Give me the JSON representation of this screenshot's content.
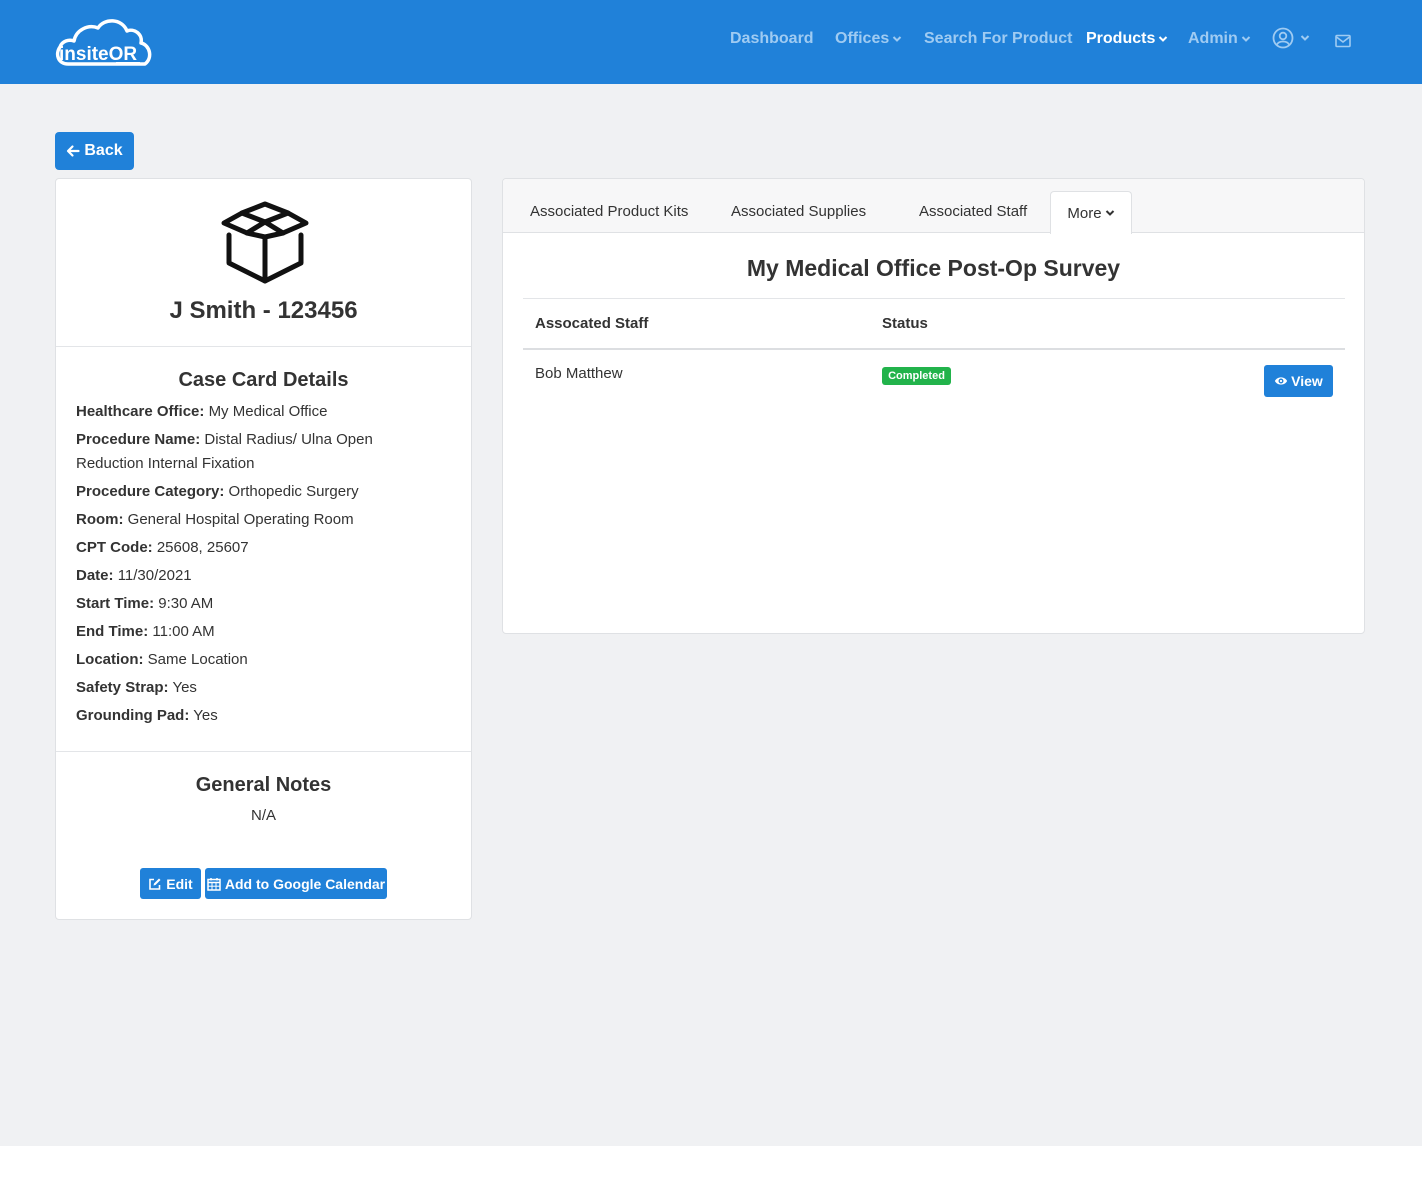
{
  "app": {
    "logo_text": "insiteOR"
  },
  "nav": {
    "dashboard": "Dashboard",
    "offices": "Offices",
    "search_for_product": "Search For Product",
    "products": "Products",
    "admin": "Admin"
  },
  "back_label": "Back",
  "case": {
    "title": "J Smith - 123456",
    "details_heading": "Case Card Details",
    "fields": [
      {
        "label": "Healthcare Office:",
        "value": "My Medical Office"
      },
      {
        "label": "Procedure Name:",
        "value": "Distal Radius/ Ulna Open Reduction Internal Fixation"
      },
      {
        "label": "Procedure Category:",
        "value": "Orthopedic Surgery"
      },
      {
        "label": "Room:",
        "value": "General Hospital Operating Room"
      },
      {
        "label": "CPT Code:",
        "value": "25608, 25607"
      },
      {
        "label": "Date:",
        "value": "11/30/2021"
      },
      {
        "label": "Start Time:",
        "value": "9:30 AM"
      },
      {
        "label": "End Time:",
        "value": "11:00 AM"
      },
      {
        "label": "Location:",
        "value": "Same Location"
      },
      {
        "label": "Safety Strap:",
        "value": "Yes"
      },
      {
        "label": "Grounding Pad:",
        "value": "Yes"
      }
    ],
    "notes_heading": "General Notes",
    "notes_value": "N/A",
    "edit_label": "Edit",
    "calendar_label": "Add to Google Calendar"
  },
  "tabs": {
    "kits": "Associated Product Kits",
    "supplies": "Associated Supplies",
    "staff": "Associated Staff",
    "more": "More"
  },
  "survey": {
    "title": "My Medical Office Post-Op Survey",
    "col_staff": "Assocated Staff",
    "col_status": "Status",
    "rows": [
      {
        "staff": "Bob Matthew",
        "status": "Completed",
        "action": "View"
      }
    ]
  },
  "colors": {
    "primary": "#2081d9",
    "nav_link": "#9fcbf2",
    "success": "#22b34b",
    "page_bg": "#f0f1f3"
  },
  "icons": {
    "logo": "cloud-logo-icon",
    "user": "user-circle-icon",
    "mail": "envelope-icon",
    "back": "arrow-left-icon",
    "case": "open-box-icon",
    "edit": "edit-icon",
    "calendar": "calendar-icon",
    "view": "eye-icon"
  }
}
